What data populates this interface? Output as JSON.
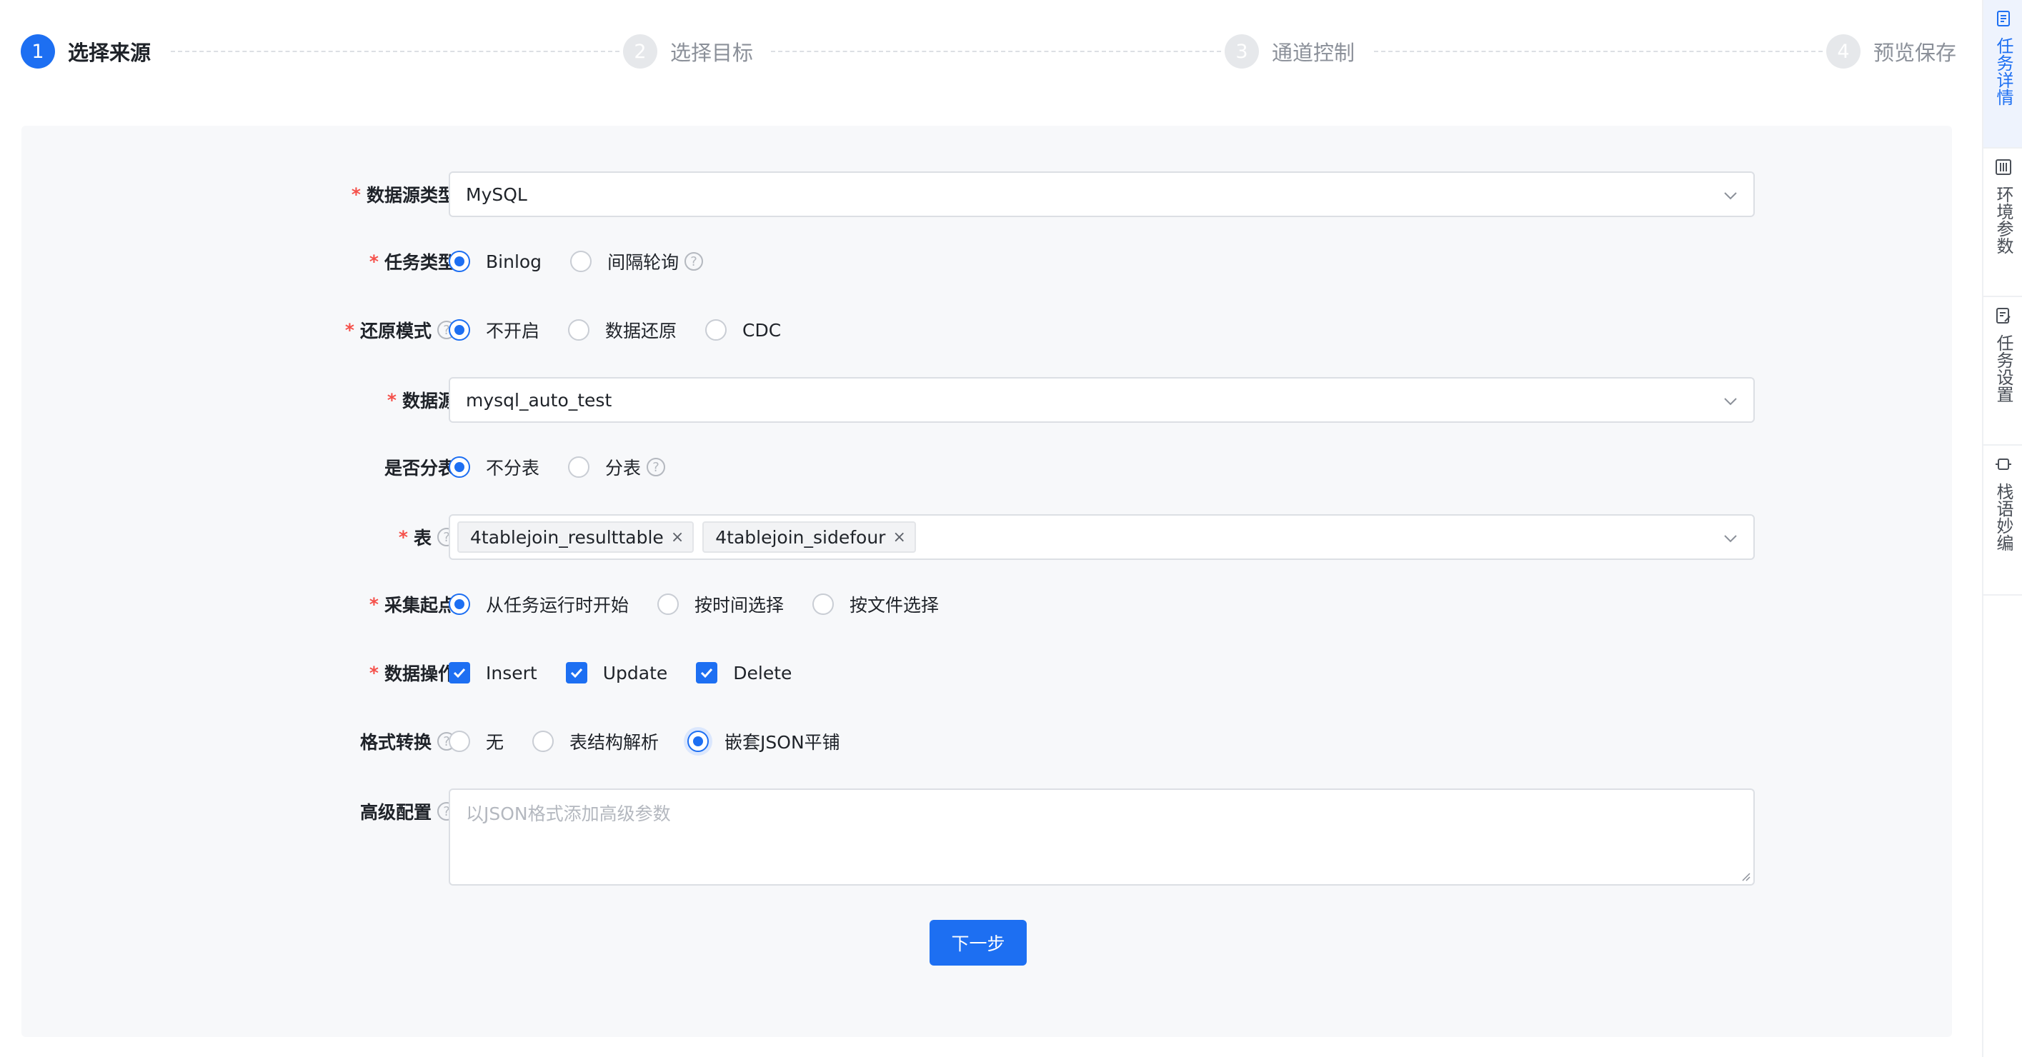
{
  "steps": [
    {
      "num": "1",
      "label": "选择来源"
    },
    {
      "num": "2",
      "label": "选择目标"
    },
    {
      "num": "3",
      "label": "通道控制"
    },
    {
      "num": "4",
      "label": "预览保存"
    }
  ],
  "sidebar": {
    "items": [
      {
        "label": "任务详情",
        "icon": "document-list-icon"
      },
      {
        "label": "环境参数",
        "icon": "sliders-icon"
      },
      {
        "label": "任务设置",
        "icon": "task-settings-icon"
      },
      {
        "label": "栈语妙编",
        "icon": "code-block-icon"
      }
    ]
  },
  "form": {
    "datasource_type": {
      "label": "数据源类型",
      "value": "MySQL"
    },
    "task_type": {
      "label": "任务类型",
      "options": [
        "Binlog",
        "间隔轮询"
      ],
      "selected": "Binlog"
    },
    "restore_mode": {
      "label": "还原模式",
      "options": [
        "不开启",
        "数据还原",
        "CDC"
      ],
      "selected": "不开启"
    },
    "datasource": {
      "label": "数据源",
      "value": "mysql_auto_test"
    },
    "sharding": {
      "label": "是否分表",
      "options": [
        "不分表",
        "分表"
      ],
      "selected": "不分表"
    },
    "tables": {
      "label": "表",
      "tags": [
        "4tablejoin_resulttable",
        "4tablejoin_sidefour"
      ]
    },
    "start_point": {
      "label": "采集起点",
      "options": [
        "从任务运行时开始",
        "按时间选择",
        "按文件选择"
      ],
      "selected": "从任务运行时开始"
    },
    "data_ops": {
      "label": "数据操作",
      "options": [
        "Insert",
        "Update",
        "Delete"
      ]
    },
    "format_convert": {
      "label": "格式转换",
      "options": [
        "无",
        "表结构解析",
        "嵌套JSON平铺"
      ],
      "selected": "嵌套JSON平铺"
    },
    "advanced": {
      "label": "高级配置",
      "placeholder": "以JSON格式添加高级参数"
    }
  },
  "next_button": "下一步",
  "help_glyph": "?",
  "tag_close_glyph": "×",
  "colors": {
    "primary": "#1d6ff2",
    "required": "#f5504a",
    "panel_bg": "#f7f8fa"
  }
}
